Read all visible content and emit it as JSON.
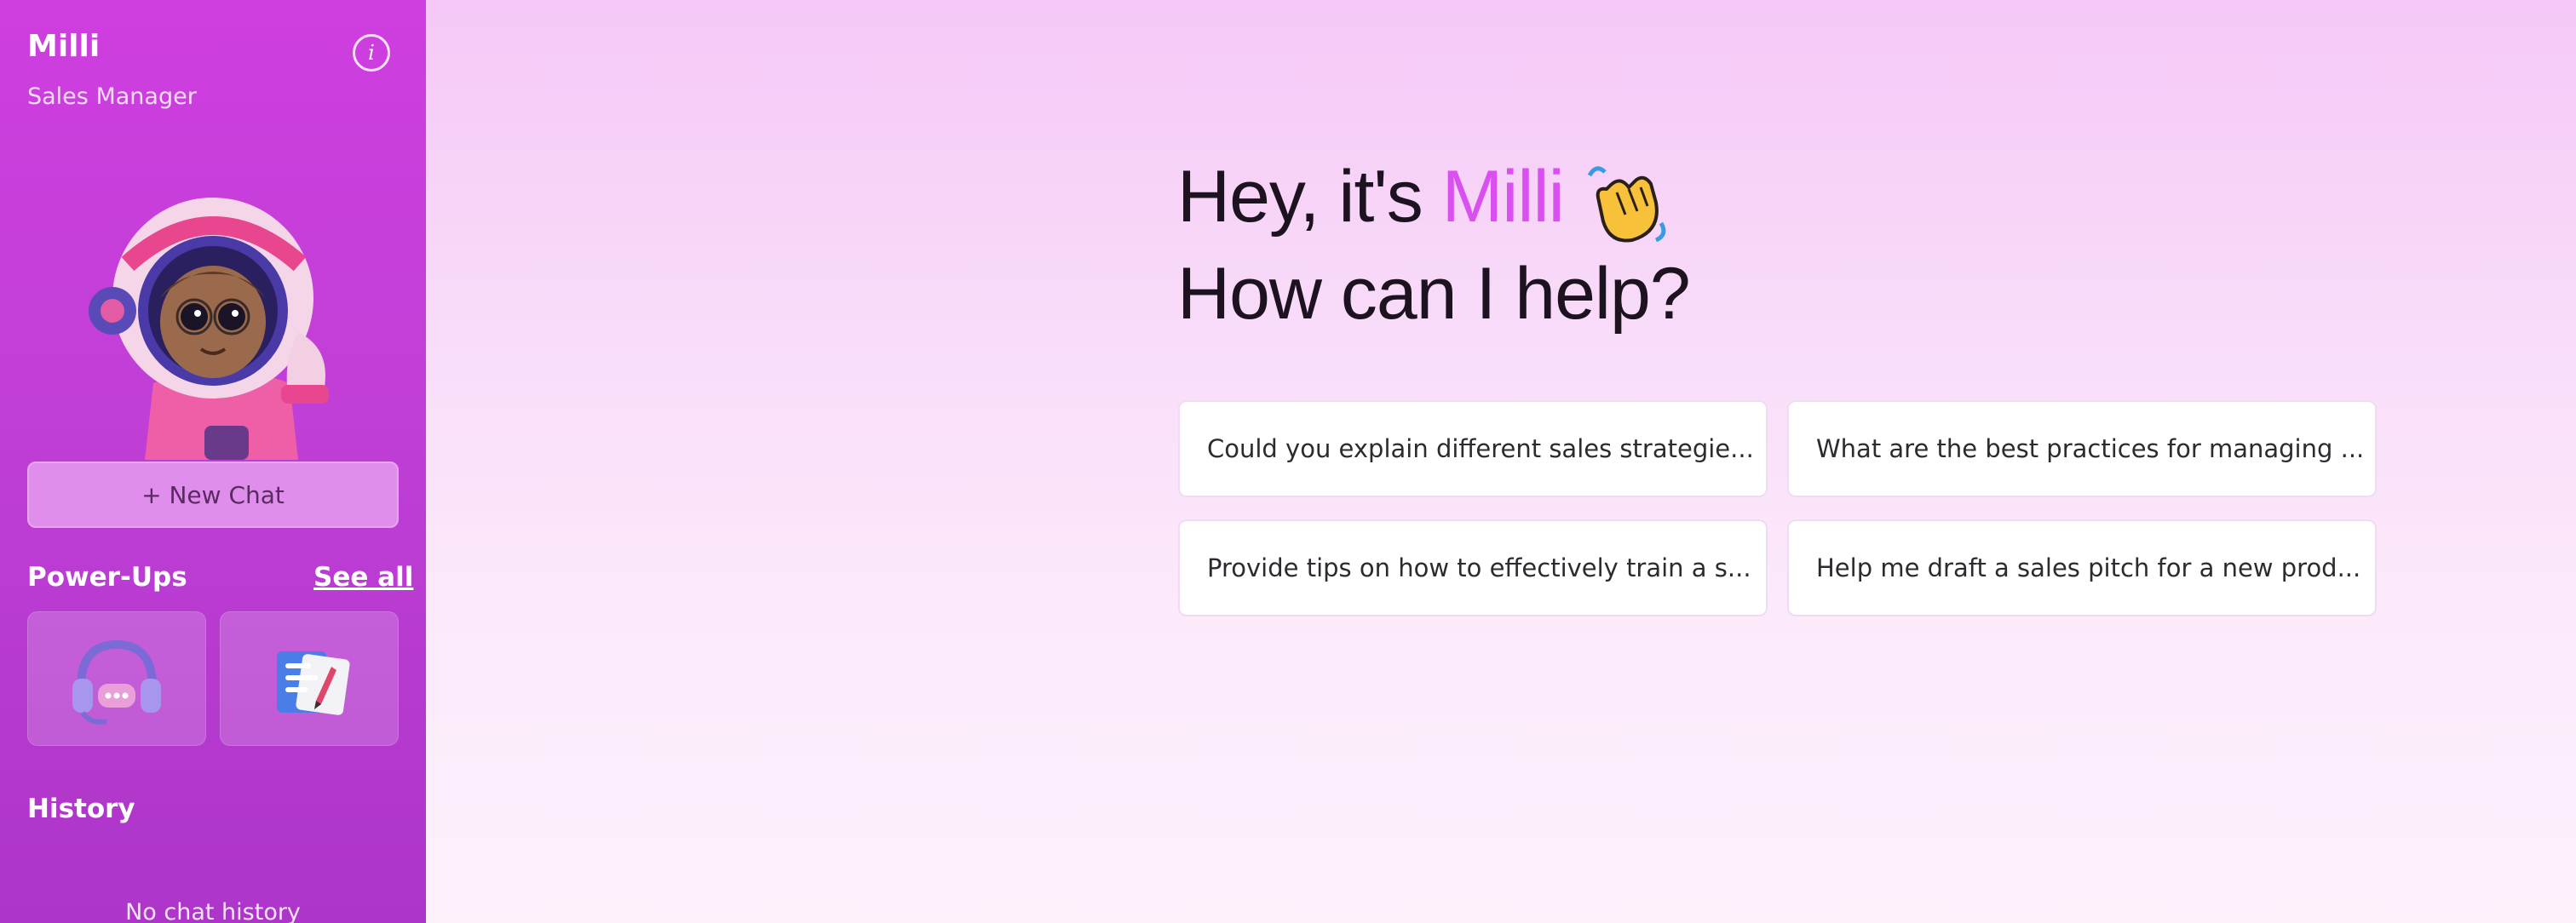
{
  "sidebar": {
    "agent_name": "Milli",
    "agent_role": "Sales Manager",
    "new_chat_label": "+ New Chat",
    "powerups_title": "Power-Ups",
    "see_all_label": "See all",
    "powerups": [
      {
        "icon": "headset-icon"
      },
      {
        "icon": "document-pen-icon"
      }
    ],
    "history_title": "History",
    "no_history_text": "No chat history"
  },
  "main": {
    "greeting_prefix": "Hey, it's ",
    "greeting_name": "Milli",
    "greeting_line2": "How can I help?",
    "suggestions": [
      "Could you explain different sales strategie...",
      "What are the best practices for managing ...",
      "Provide tips on how to effectively train a s...",
      "Help me draft a sales pitch for a new prod..."
    ]
  },
  "colors": {
    "sidebar_accent": "#c03fd6",
    "name_accent": "#d94ff0",
    "background": "#fdf1fc"
  }
}
